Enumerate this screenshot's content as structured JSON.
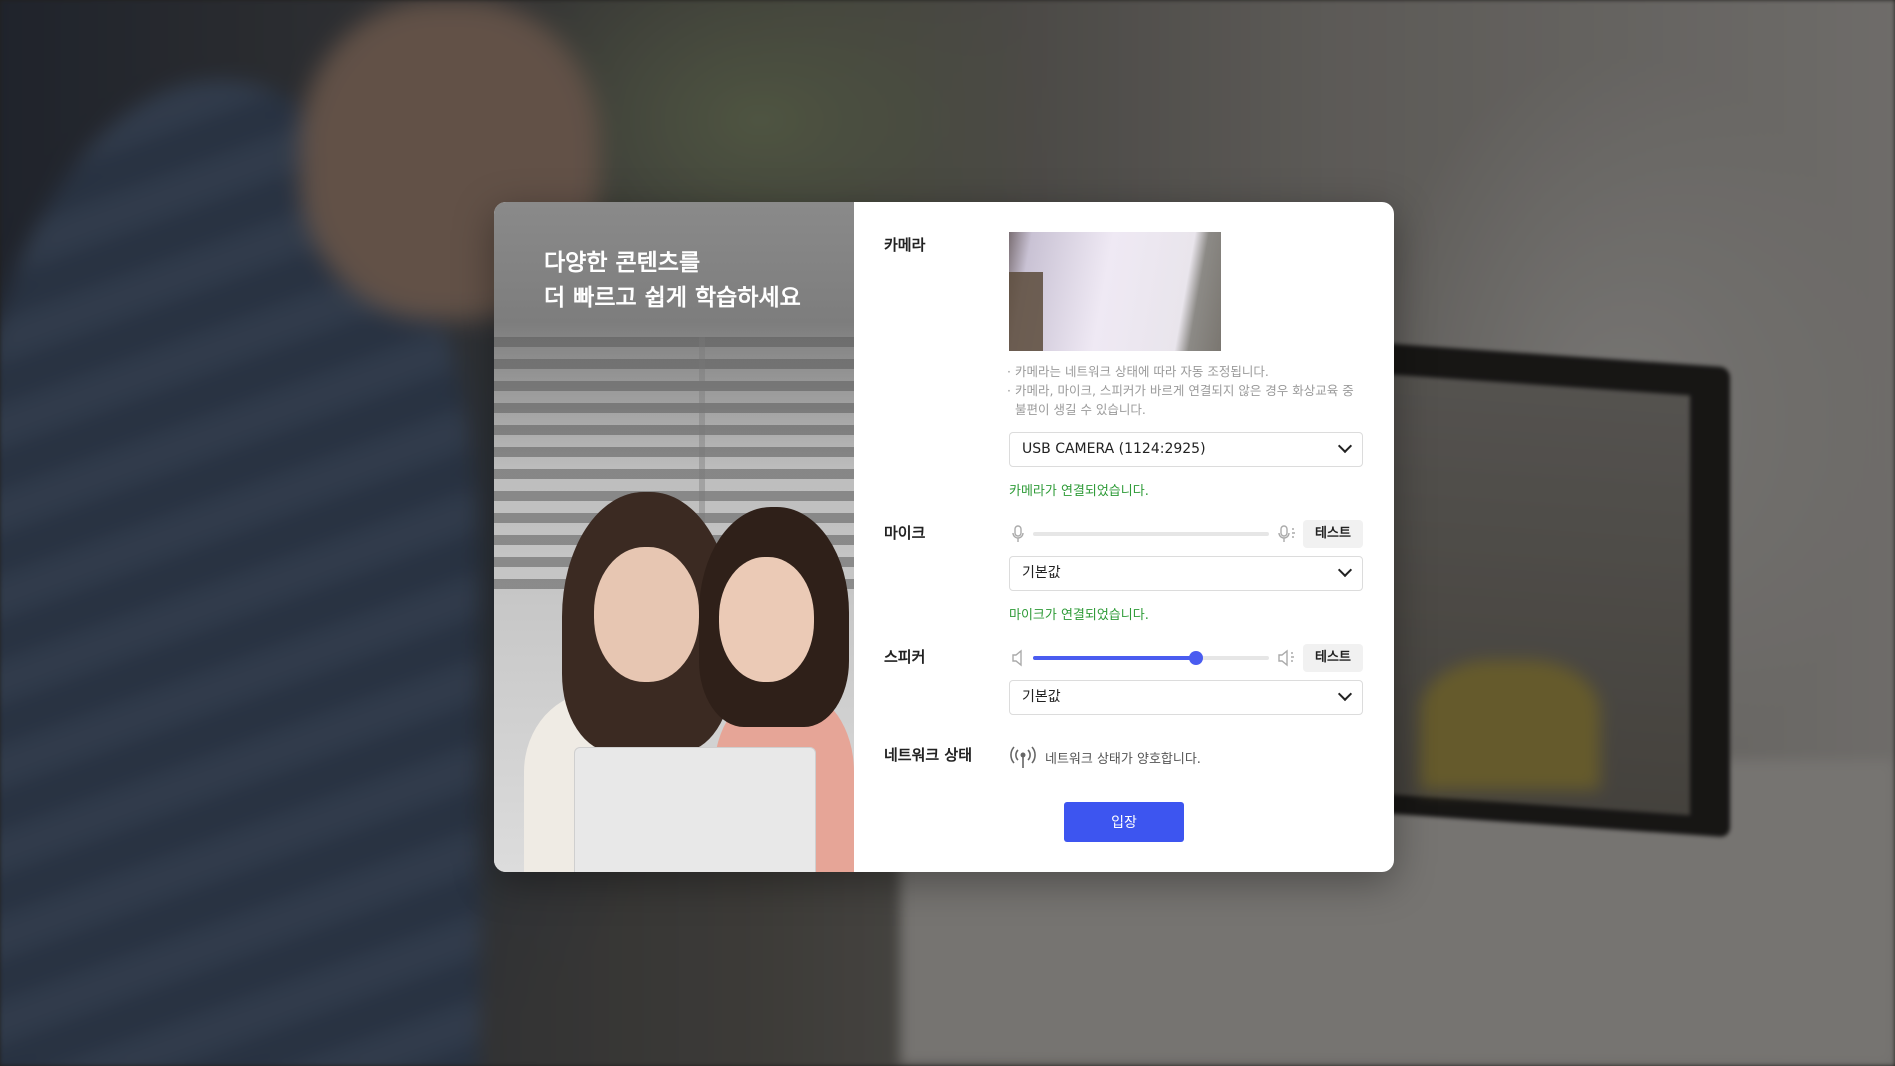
{
  "promo": {
    "headline": "다양한 콘텐츠를\n더 빠르고 쉽게 학습하세요"
  },
  "camera": {
    "label": "카메라",
    "notes": [
      "카메라는 네트워크 상태에 따라 자동 조정됩니다.",
      "카메라, 마이크, 스피커가 바르게 연결되지 않은 경우 화상교육 중 불편이 생길 수 있습니다."
    ],
    "selected_device": "USB CAMERA (1124:2925)",
    "status": "카메라가 연결되었습니다."
  },
  "mic": {
    "label": "마이크",
    "level": 0,
    "test_label": "테스트",
    "selected_device": "기본값",
    "status": "마이크가 연결되었습니다."
  },
  "speaker": {
    "label": "스피커",
    "volume": 0.69,
    "test_label": "테스트",
    "selected_device": "기본값"
  },
  "network": {
    "label": "네트워크 상태",
    "status": "네트워크 상태가 양호합니다."
  },
  "enter_button": "입장",
  "colors": {
    "accent": "#3d55f0",
    "success": "#2e9b37"
  },
  "icons": {
    "mic_min": "mic-icon",
    "mic_max": "mic-loud-icon",
    "speaker_min": "speaker-mute-icon",
    "speaker_max": "speaker-loud-icon",
    "network": "signal-antenna-icon",
    "dropdown": "chevron-down-icon"
  }
}
